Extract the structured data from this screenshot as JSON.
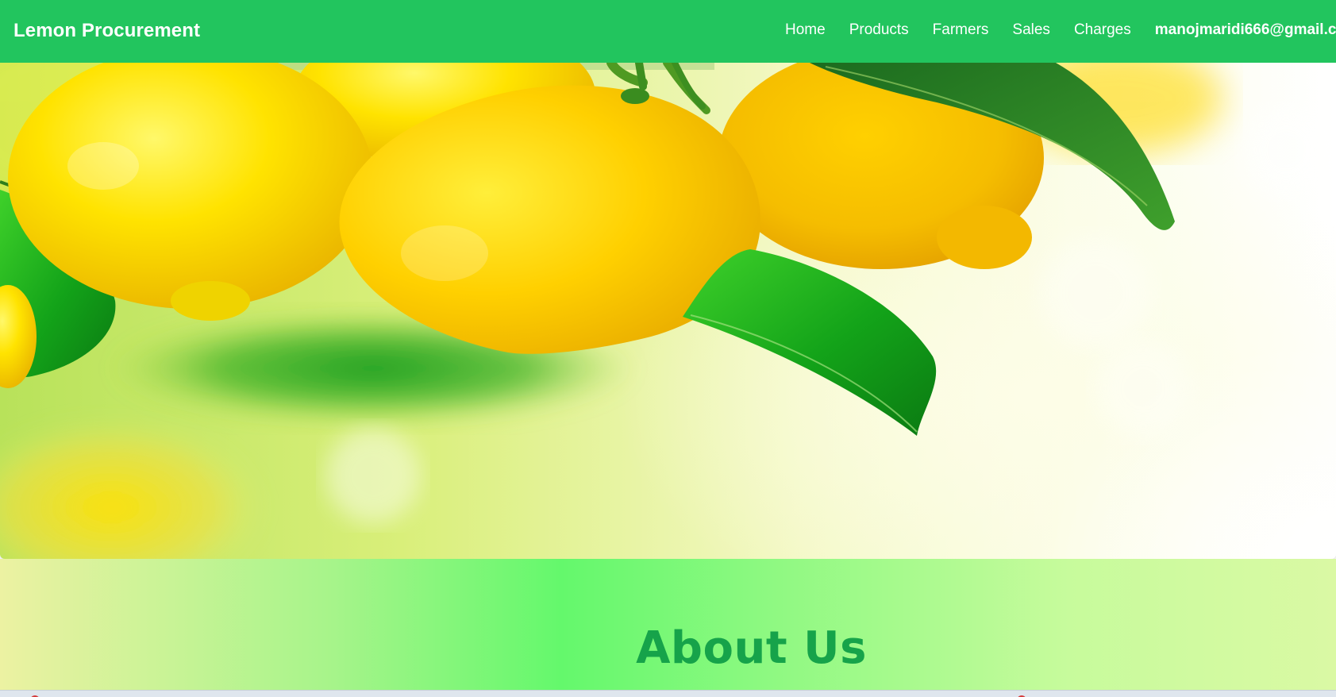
{
  "navbar": {
    "brand": "Lemon Procurement",
    "links": [
      "Home",
      "Products",
      "Farmers",
      "Sales",
      "Charges"
    ],
    "user_email": "manojmaridi666@gmail.c"
  },
  "hero": {
    "image_subject": "lemons-on-branch-image"
  },
  "about": {
    "title": "About Us"
  },
  "colors": {
    "navbar_bg": "#22c55e",
    "about_title": "#16a34a",
    "nav_text": "#ffffff"
  }
}
